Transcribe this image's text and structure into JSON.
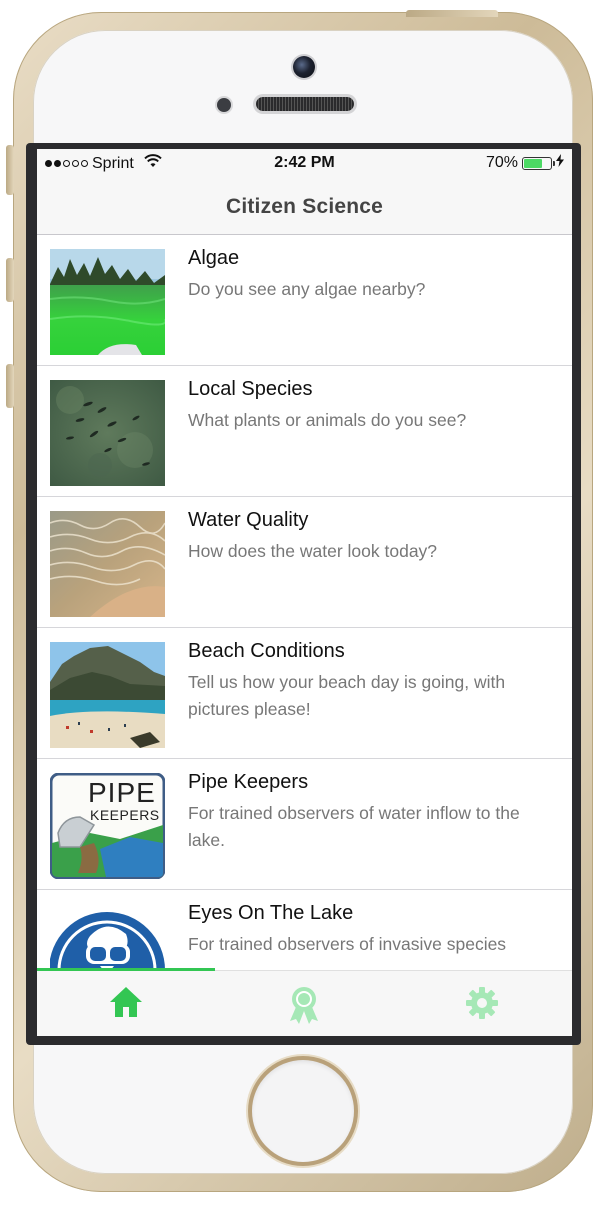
{
  "status_bar": {
    "carrier": "Sprint",
    "signal_bars_filled": 2,
    "signal_bars_total": 5,
    "time": "2:42 PM",
    "battery_percent": "70%",
    "battery_level": 0.7
  },
  "nav": {
    "title": "Citizen Science"
  },
  "list": {
    "items": [
      {
        "title": "Algae",
        "subtitle": "Do you see any algae nearby?",
        "thumb_icon": "algae-photo"
      },
      {
        "title": "Local Species",
        "subtitle": "What plants or animals do you see?",
        "thumb_icon": "fish-water-photo"
      },
      {
        "title": "Water Quality",
        "subtitle": "How does the water look today?",
        "thumb_icon": "shore-water-photo"
      },
      {
        "title": "Beach Conditions",
        "subtitle": "Tell us how your beach day is going, with pictures please!",
        "thumb_icon": "beach-photo"
      },
      {
        "title": "Pipe Keepers",
        "subtitle": "For trained observers of water inflow to the lake.",
        "thumb_icon": "pipe-keepers-logo",
        "logo_text_1": "PIPE",
        "logo_text_2": "KEEPERS"
      },
      {
        "title": "Eyes On The Lake",
        "subtitle": "For trained observers of invasive species",
        "thumb_icon": "eyes-on-the-lake-logo"
      }
    ]
  },
  "tab_bar": {
    "active": "home",
    "tabs": [
      {
        "id": "home",
        "icon": "home-icon",
        "color": "#33c653"
      },
      {
        "id": "awards",
        "icon": "award-ribbon-icon",
        "color": "#a6e8b6"
      },
      {
        "id": "settings",
        "icon": "gear-icon",
        "color": "#a6e8b6"
      }
    ]
  },
  "colors": {
    "accent": "#33c653",
    "accent_inactive": "#a6e8b6",
    "subtitle": "#777777",
    "nav_background": "#f7f7f7"
  }
}
